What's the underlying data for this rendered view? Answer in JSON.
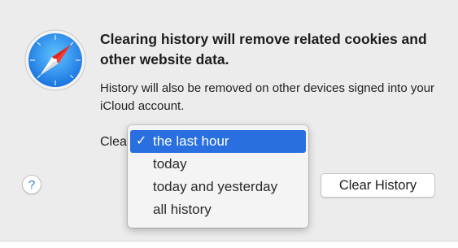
{
  "dialog": {
    "heading": "Clearing history will remove related cookies and other website data.",
    "info": "History will also be removed on other devices signed into your iCloud account.",
    "clear_label": "Clear",
    "help_label": "?",
    "primary_button_label": "Clear History",
    "app_icon": "safari-compass-icon"
  },
  "dropdown": {
    "selected_check": "✓",
    "items": [
      {
        "label": "the last hour",
        "selected": true
      },
      {
        "label": "today",
        "selected": false
      },
      {
        "label": "today and yesterday",
        "selected": false
      },
      {
        "label": "all history",
        "selected": false
      }
    ]
  },
  "colors": {
    "selection": "#2a6fe0",
    "dialog_background": "#ececec",
    "help_glyph": "#2f77e0"
  }
}
